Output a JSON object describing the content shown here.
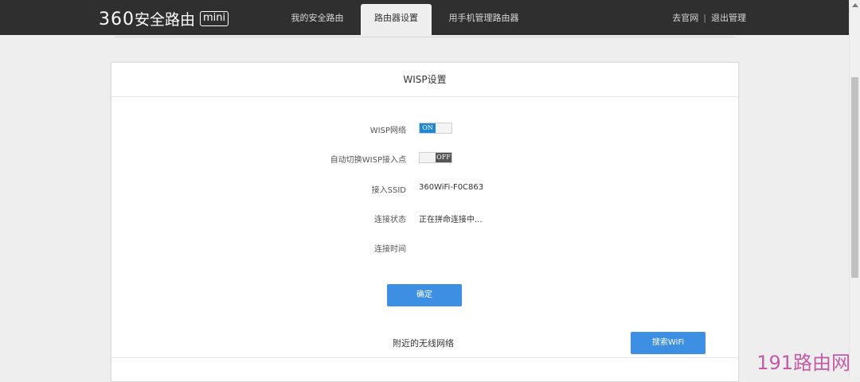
{
  "header": {
    "logo_num": "360",
    "logo_text": "安全路由",
    "logo_badge": "mini",
    "tabs": [
      {
        "label": "我的安全路由"
      },
      {
        "label": "路由器设置"
      },
      {
        "label": "用手机管理路由器"
      }
    ],
    "active_tab": "路由器设置",
    "links": {
      "official_site": "去官网",
      "separator": "|",
      "logout": "退出管理"
    }
  },
  "wisp": {
    "title": "WISP设置",
    "fields": [
      {
        "label": "WISP网络",
        "toggle": "ON"
      },
      {
        "label": "自动切换WISP接入点",
        "toggle": "OFF"
      },
      {
        "label": "接入SSID",
        "value": "360WiFi-F0C863"
      },
      {
        "label": "连接状态",
        "value": "正在拼命连接中..."
      },
      {
        "label": "连接时间",
        "value": ""
      }
    ],
    "confirm_label": "确定"
  },
  "nearby": {
    "title": "附近的无线网络",
    "search_label": "搜索WiFi"
  },
  "watermark": "191路由网",
  "colors": {
    "topbar": "#2f2f2f",
    "accent": "#3d8fe4",
    "toggle_on": "#1e88d8",
    "toggle_off": "#555555",
    "watermark": "#c45aa6"
  }
}
